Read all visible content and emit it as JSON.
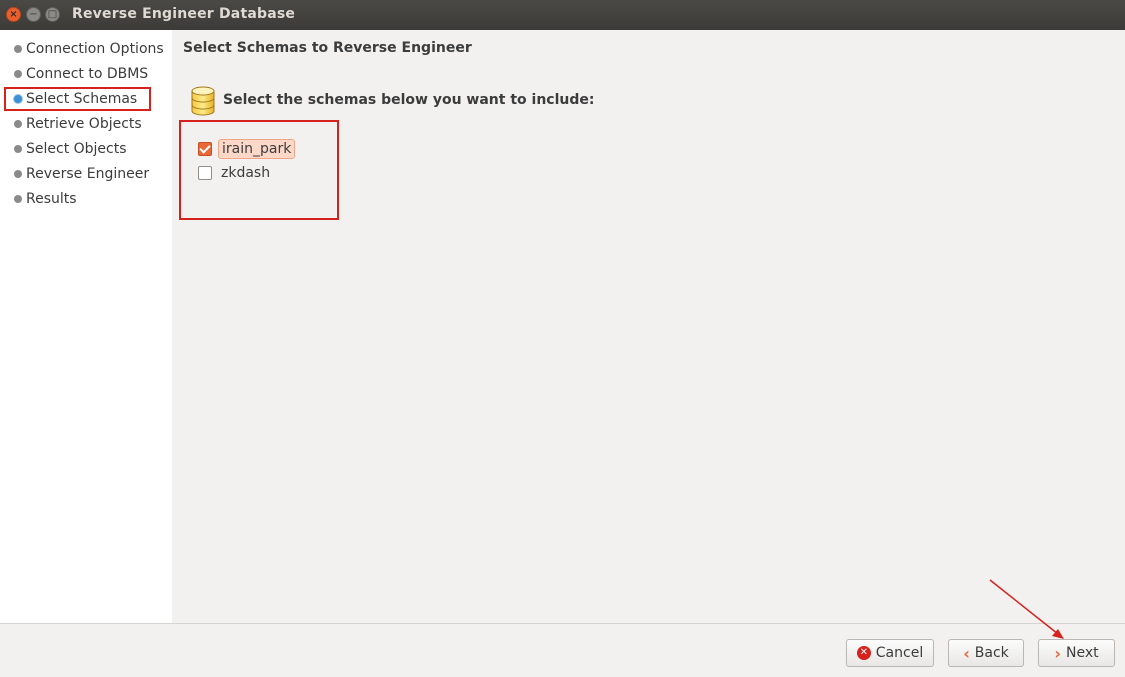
{
  "window": {
    "title": "Reverse Engineer Database",
    "close_glyph": "×",
    "min_glyph": "−",
    "max_glyph": "□"
  },
  "sidebar": {
    "steps": [
      {
        "label": "Connection Options",
        "state": "done"
      },
      {
        "label": "Connect to DBMS",
        "state": "done"
      },
      {
        "label": "Select Schemas",
        "state": "active"
      },
      {
        "label": "Retrieve Objects",
        "state": "pending"
      },
      {
        "label": "Select Objects",
        "state": "pending"
      },
      {
        "label": "Reverse Engineer",
        "state": "pending"
      },
      {
        "label": "Results",
        "state": "pending"
      }
    ]
  },
  "main": {
    "title": "Select Schemas to Reverse Engineer",
    "instruction": "Select the schemas below you want to include:",
    "icon": "database-icon",
    "schemas": [
      {
        "name": "irain_park",
        "checked": true
      },
      {
        "name": "zkdash",
        "checked": false
      }
    ]
  },
  "footer": {
    "cancel_label": "Cancel",
    "back_label": "Back",
    "next_label": "Next",
    "cancel_icon": "cancel-icon",
    "back_icon": "chevron-left-icon",
    "next_icon": "chevron-right-icon"
  },
  "colors": {
    "annotation": "#d7211c",
    "accent": "#e9683a",
    "active_step": "#3d8fd6"
  }
}
